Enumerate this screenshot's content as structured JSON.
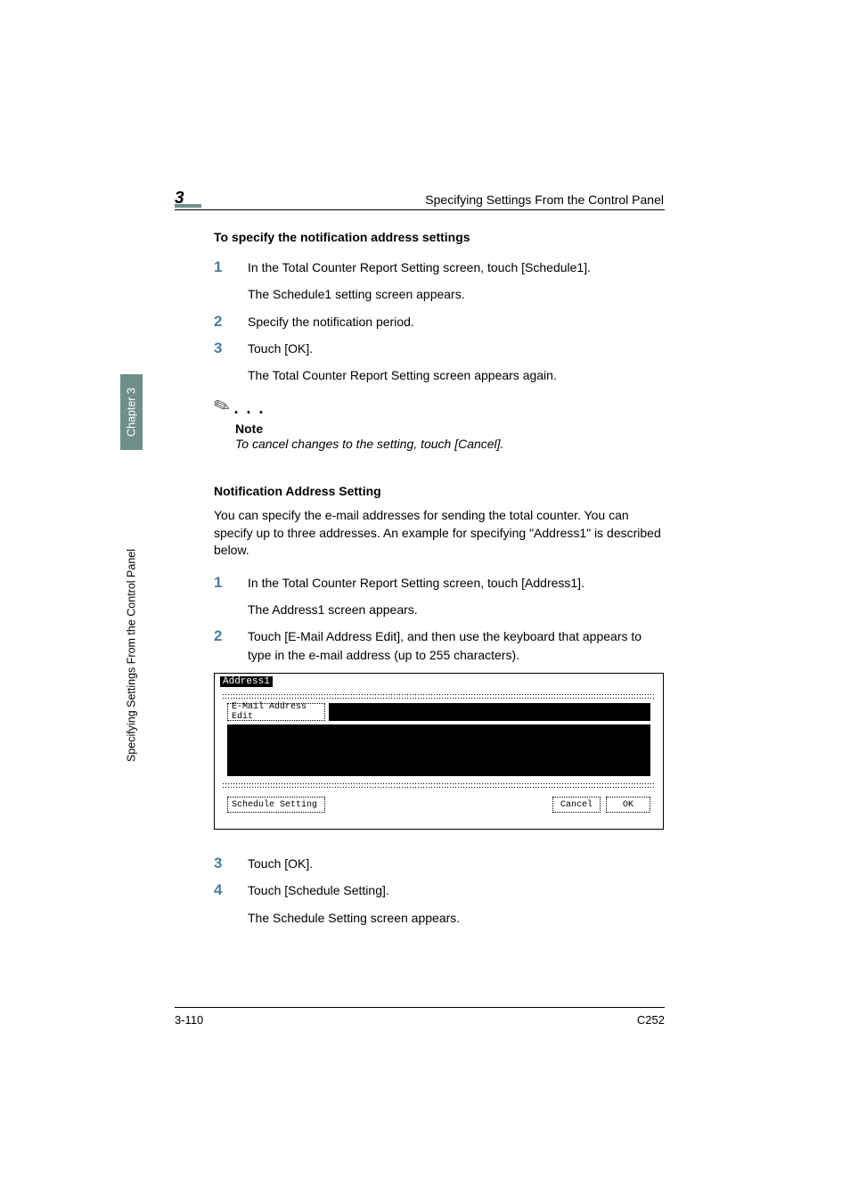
{
  "chapter_number": "3",
  "header_title": "Specifying Settings From the Control Panel",
  "side_chapter": "Chapter 3",
  "side_title": "Specifying Settings From the Control Panel",
  "section1": {
    "heading": "To specify the notification address settings",
    "steps": [
      {
        "n": "1",
        "line1": "In the Total Counter Report Setting screen, touch [Schedule1].",
        "line2": "The Schedule1 setting screen appears."
      },
      {
        "n": "2",
        "line1": "Specify the notification period."
      },
      {
        "n": "3",
        "line1": "Touch [OK].",
        "line2": "The Total Counter Report Setting screen appears again."
      }
    ]
  },
  "note": {
    "label": "Note",
    "body": "To cancel changes to the setting, touch [Cancel]."
  },
  "section2": {
    "heading": "Notification Address Setting",
    "intro": "You can specify the e-mail addresses for sending the total counter. You can specify up to three addresses. An example for specifying \"Address1\" is described below.",
    "steps": [
      {
        "n": "1",
        "line1": "In the Total Counter Report Setting screen, touch [Address1].",
        "line2": "The Address1 screen appears."
      },
      {
        "n": "2",
        "line1": "Touch [E-Mail Address Edit], and then use the keyboard that appears to type in the e-mail address (up to 255 characters)."
      }
    ]
  },
  "screenshot": {
    "title": "Address1",
    "email_edit": "E-Mail Address Edit",
    "schedule_setting": "Schedule Setting",
    "cancel": "Cancel",
    "ok": "OK"
  },
  "section3": {
    "steps": [
      {
        "n": "3",
        "line1": "Touch [OK]."
      },
      {
        "n": "4",
        "line1": "Touch [Schedule Setting].",
        "line2": "The Schedule Setting screen appears."
      }
    ]
  },
  "footer": {
    "left": "3-110",
    "right": "C252"
  }
}
